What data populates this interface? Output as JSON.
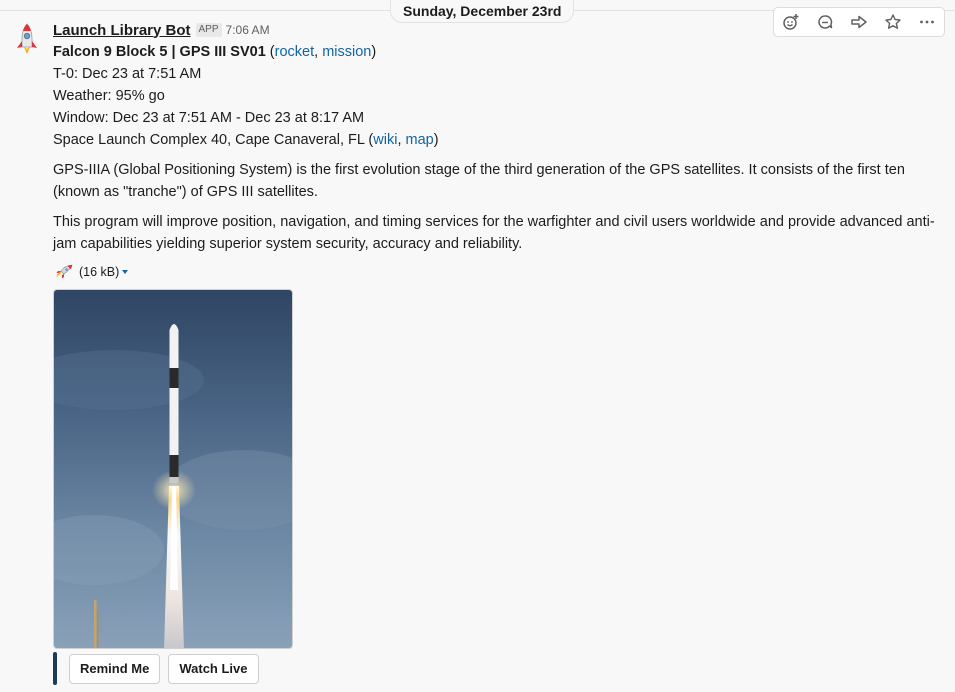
{
  "date_divider": "Sunday, December 23rd",
  "message": {
    "sender": "Launch Library Bot",
    "badge": "APP",
    "time": "7:06 AM",
    "title": "Falcon 9 Block 5 | GPS III SV01",
    "title_link_1": "rocket",
    "title_link_2": "mission",
    "t0": "T-0: Dec 23 at 7:51 AM",
    "weather": "Weather: 95% go",
    "window": "Window: Dec 23 at 7:51 AM - Dec 23 at 8:17 AM",
    "location": "Space Launch Complex 40, Cape Canaveral, FL",
    "location_link_1": "wiki",
    "location_link_2": "map",
    "paragraph_1": "GPS-IIIA (Global Positioning System) is the first evolution stage of the third generation of the GPS satellites. It consists of the first ten (known as \"tranche\") of GPS III satellites.",
    "paragraph_2": "This program will improve position, navigation, and timing services for the warfighter and civil users worldwide and provide advanced anti-jam capabilities yielding superior system security, accuracy and reliability.",
    "attachment_size": "(16 kB)"
  },
  "buttons": {
    "remind": "Remind Me",
    "watch": "Watch Live"
  },
  "icons": {
    "avatar": "rocket-icon",
    "attachment": "rocket-icon",
    "actions": [
      "add-reaction-icon",
      "reply-in-thread-icon",
      "share-icon",
      "star-icon",
      "more-actions-icon"
    ]
  },
  "colors": {
    "link": "#1264a3",
    "attachment_bar": "#1d3c5a"
  }
}
